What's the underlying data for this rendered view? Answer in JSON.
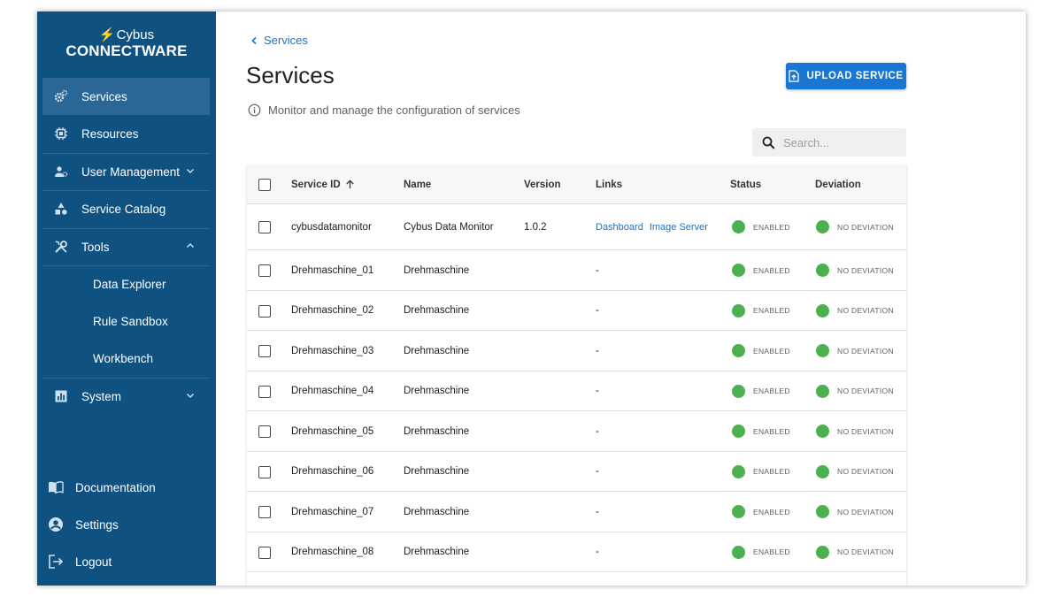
{
  "logo": {
    "top": "Cybus",
    "main": "CONNECTWARE"
  },
  "sidebar": {
    "items": [
      {
        "label": "Services",
        "icon": "gears-icon"
      },
      {
        "label": "Resources",
        "icon": "chip-icon"
      },
      {
        "label": "User Management",
        "icon": "users-icon"
      },
      {
        "label": "Service Catalog",
        "icon": "shapes-icon"
      },
      {
        "label": "Tools",
        "icon": "tools-icon"
      },
      {
        "label": "System",
        "icon": "bar-chart-icon"
      }
    ],
    "tools_sub": [
      "Data Explorer",
      "Rule Sandbox",
      "Workbench"
    ],
    "bottom": [
      {
        "label": "Documentation",
        "icon": "book-icon"
      },
      {
        "label": "Settings",
        "icon": "account-circle-icon"
      },
      {
        "label": "Logout",
        "icon": "logout-icon"
      }
    ]
  },
  "breadcrumb": {
    "label": "Services"
  },
  "page": {
    "title": "Services",
    "description": "Monitor and manage the configuration of services",
    "upload_label": "UPLOAD SERVICE"
  },
  "search": {
    "placeholder": "Search..."
  },
  "table": {
    "headers": {
      "service_id": "Service ID",
      "name": "Name",
      "version": "Version",
      "links": "Links",
      "status": "Status",
      "deviation": "Deviation"
    },
    "rows": [
      {
        "id": "cybusdatamonitor",
        "name": "Cybus Data Monitor",
        "version": "1.0.2",
        "links": [
          "Dashboard",
          "Image Server"
        ],
        "status": "ENABLED",
        "deviation": "NO DEVIATION"
      },
      {
        "id": "Drehmaschine_01",
        "name": "Drehmaschine",
        "version": "",
        "links": [
          "-"
        ],
        "status": "ENABLED",
        "deviation": "NO DEVIATION"
      },
      {
        "id": "Drehmaschine_02",
        "name": "Drehmaschine",
        "version": "",
        "links": [
          "-"
        ],
        "status": "ENABLED",
        "deviation": "NO DEVIATION"
      },
      {
        "id": "Drehmaschine_03",
        "name": "Drehmaschine",
        "version": "",
        "links": [
          "-"
        ],
        "status": "ENABLED",
        "deviation": "NO DEVIATION"
      },
      {
        "id": "Drehmaschine_04",
        "name": "Drehmaschine",
        "version": "",
        "links": [
          "-"
        ],
        "status": "ENABLED",
        "deviation": "NO DEVIATION"
      },
      {
        "id": "Drehmaschine_05",
        "name": "Drehmaschine",
        "version": "",
        "links": [
          "-"
        ],
        "status": "ENABLED",
        "deviation": "NO DEVIATION"
      },
      {
        "id": "Drehmaschine_06",
        "name": "Drehmaschine",
        "version": "",
        "links": [
          "-"
        ],
        "status": "ENABLED",
        "deviation": "NO DEVIATION"
      },
      {
        "id": "Drehmaschine_07",
        "name": "Drehmaschine",
        "version": "",
        "links": [
          "-"
        ],
        "status": "ENABLED",
        "deviation": "NO DEVIATION"
      },
      {
        "id": "Drehmaschine_08",
        "name": "Drehmaschine",
        "version": "",
        "links": [
          "-"
        ],
        "status": "ENABLED",
        "deviation": "NO DEVIATION"
      }
    ]
  },
  "colors": {
    "sidebar": "#0f5282",
    "accent": "#1976d2",
    "status_ok": "#4caf50"
  }
}
